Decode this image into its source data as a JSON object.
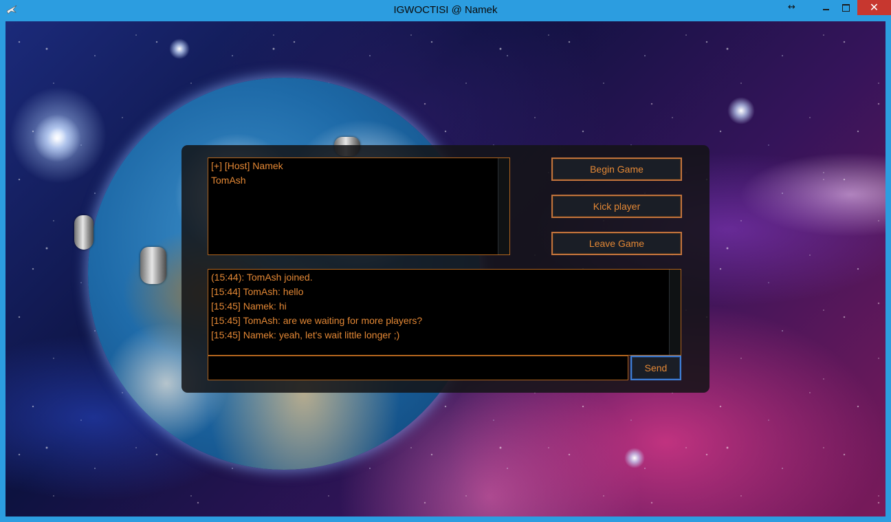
{
  "window": {
    "title": "IGWOCTISI @ Namek",
    "resize_glyph": "↔",
    "close_glyph": "✕"
  },
  "lobby": {
    "players": [
      "[+] [Host] Namek",
      "TomAsh"
    ],
    "buttons": {
      "begin": "Begin Game",
      "kick": "Kick player",
      "leave": "Leave Game"
    },
    "chat": [
      "(15:44): TomAsh joined.",
      "[15:44] TomAsh: hello",
      "[15:45] Namek: hi",
      "[15:45] TomAsh: are we waiting for more players?",
      "[15:45] Namek: yeah, let's wait little longer ;)"
    ],
    "input_value": "",
    "send_label": "Send"
  },
  "colors": {
    "titlebar": "#2c9de0",
    "text_orange": "#e48835",
    "border_orange": "#c1733c",
    "send_border": "#3f7fd6",
    "close_red": "#c7372f"
  }
}
